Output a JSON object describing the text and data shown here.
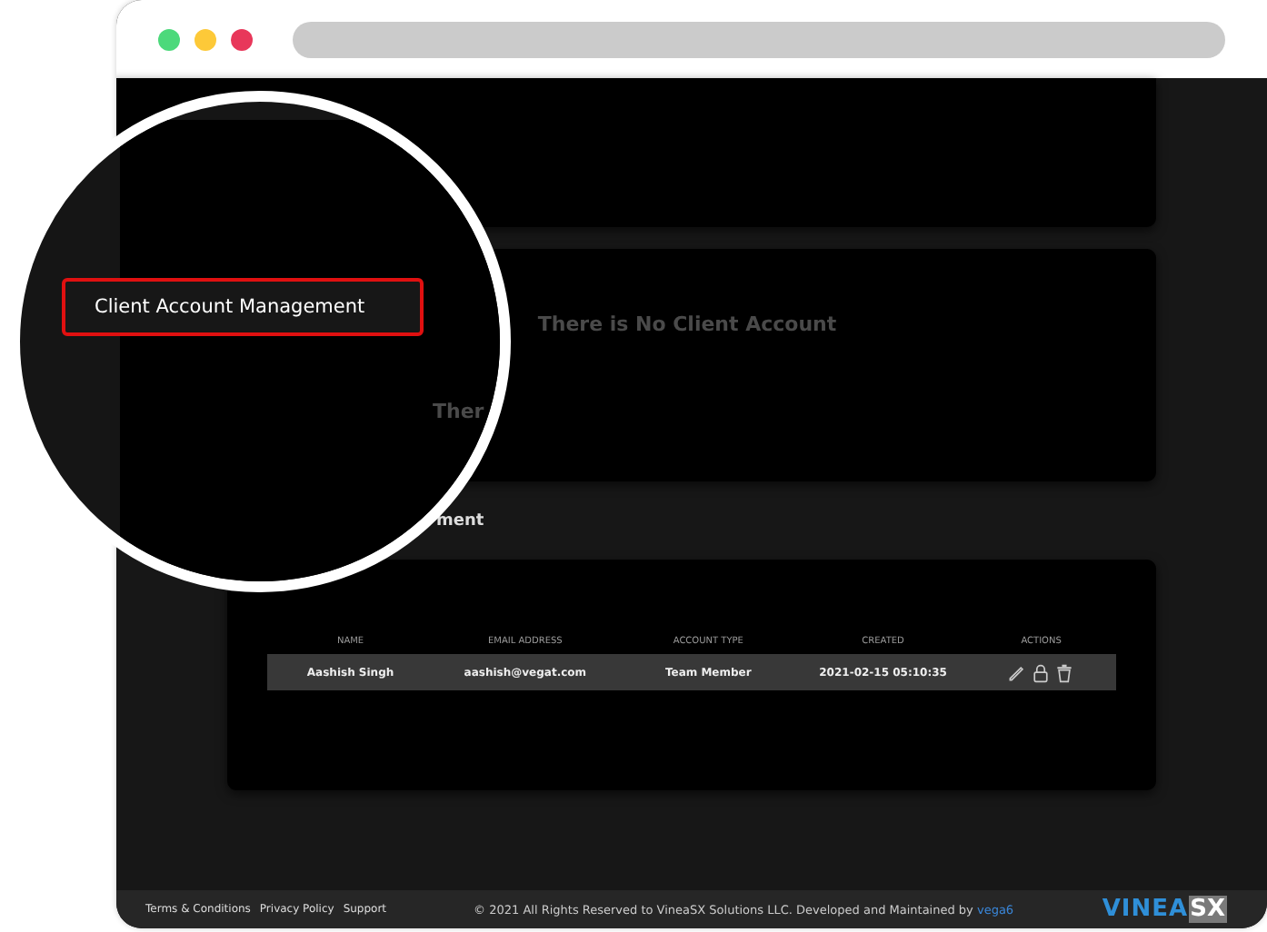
{
  "browser": {
    "dots": [
      {
        "color": "#4cd97b"
      },
      {
        "color": "#fdc938"
      },
      {
        "color": "#e8375a"
      }
    ]
  },
  "empty_card": {
    "message": "There is No Client Account"
  },
  "section_title": "ment",
  "table": {
    "columns": [
      "NAME",
      "EMAIL ADDRESS",
      "ACCOUNT TYPE",
      "CREATED",
      "ACTIONS"
    ],
    "rows": [
      {
        "cells": [
          "Aashish Singh",
          "aashish@vegat.com",
          "Team Member",
          "2021-02-15 05:10:35"
        ],
        "actions": [
          {
            "kind": "edit"
          },
          {
            "kind": "lock"
          },
          {
            "kind": "delete"
          }
        ]
      }
    ]
  },
  "footer": {
    "links": [
      "Terms & Conditions",
      "Privacy Policy",
      "Support"
    ],
    "copyright": "© 2021 All Rights Reserved to VineaSX Solutions LLC. Developed and Maintained by",
    "credit_link": "vega6",
    "logo": [
      "VINEA",
      "SX"
    ]
  },
  "magnifier": {
    "label": "Client Account Management",
    "partial_text": "Ther"
  }
}
